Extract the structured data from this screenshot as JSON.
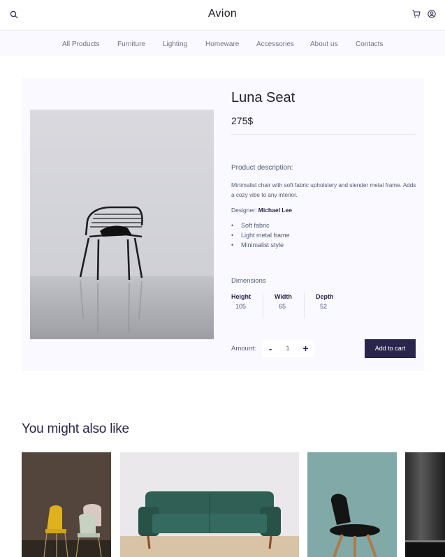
{
  "header": {
    "brand": "Avion",
    "icons": [
      "search-icon",
      "cart-icon",
      "user-icon"
    ]
  },
  "nav": {
    "items": [
      "All Products",
      "Furniture",
      "Lighting",
      "Homeware",
      "Accessories",
      "About us",
      "Contacts"
    ]
  },
  "product": {
    "title": "Luna Seat",
    "price": "275$",
    "description_heading": "Product description:",
    "description": "Minimalist chair with soft fabric upholstery and slender metal frame. Adds a cozy vibe to any interior.",
    "designer_label": "Designer:",
    "designer_name": "Michael Lee",
    "features": [
      "Soft fabric",
      "Light metal frame",
      "Minimalist style"
    ],
    "dimensions_heading": "Dimensions",
    "dimensions": [
      {
        "label": "Height",
        "value": "105"
      },
      {
        "label": "Width",
        "value": "65"
      },
      {
        "label": "Depth",
        "value": "52"
      }
    ],
    "amount_label": "Amount:",
    "quantity": "1",
    "minus_label": "-",
    "plus_label": "+",
    "add_to_cart_label": "Add to cart"
  },
  "related": {
    "title": "You might also like",
    "items": [
      {
        "image": "yellow-chairs-photo"
      },
      {
        "image": "green-sofa-photo"
      },
      {
        "image": "black-chair-photo"
      },
      {
        "image": "dark-interior-photo"
      }
    ]
  },
  "colors": {
    "primary": "#2a254b",
    "panel": "#f9f9ff",
    "text_muted": "#505977"
  }
}
